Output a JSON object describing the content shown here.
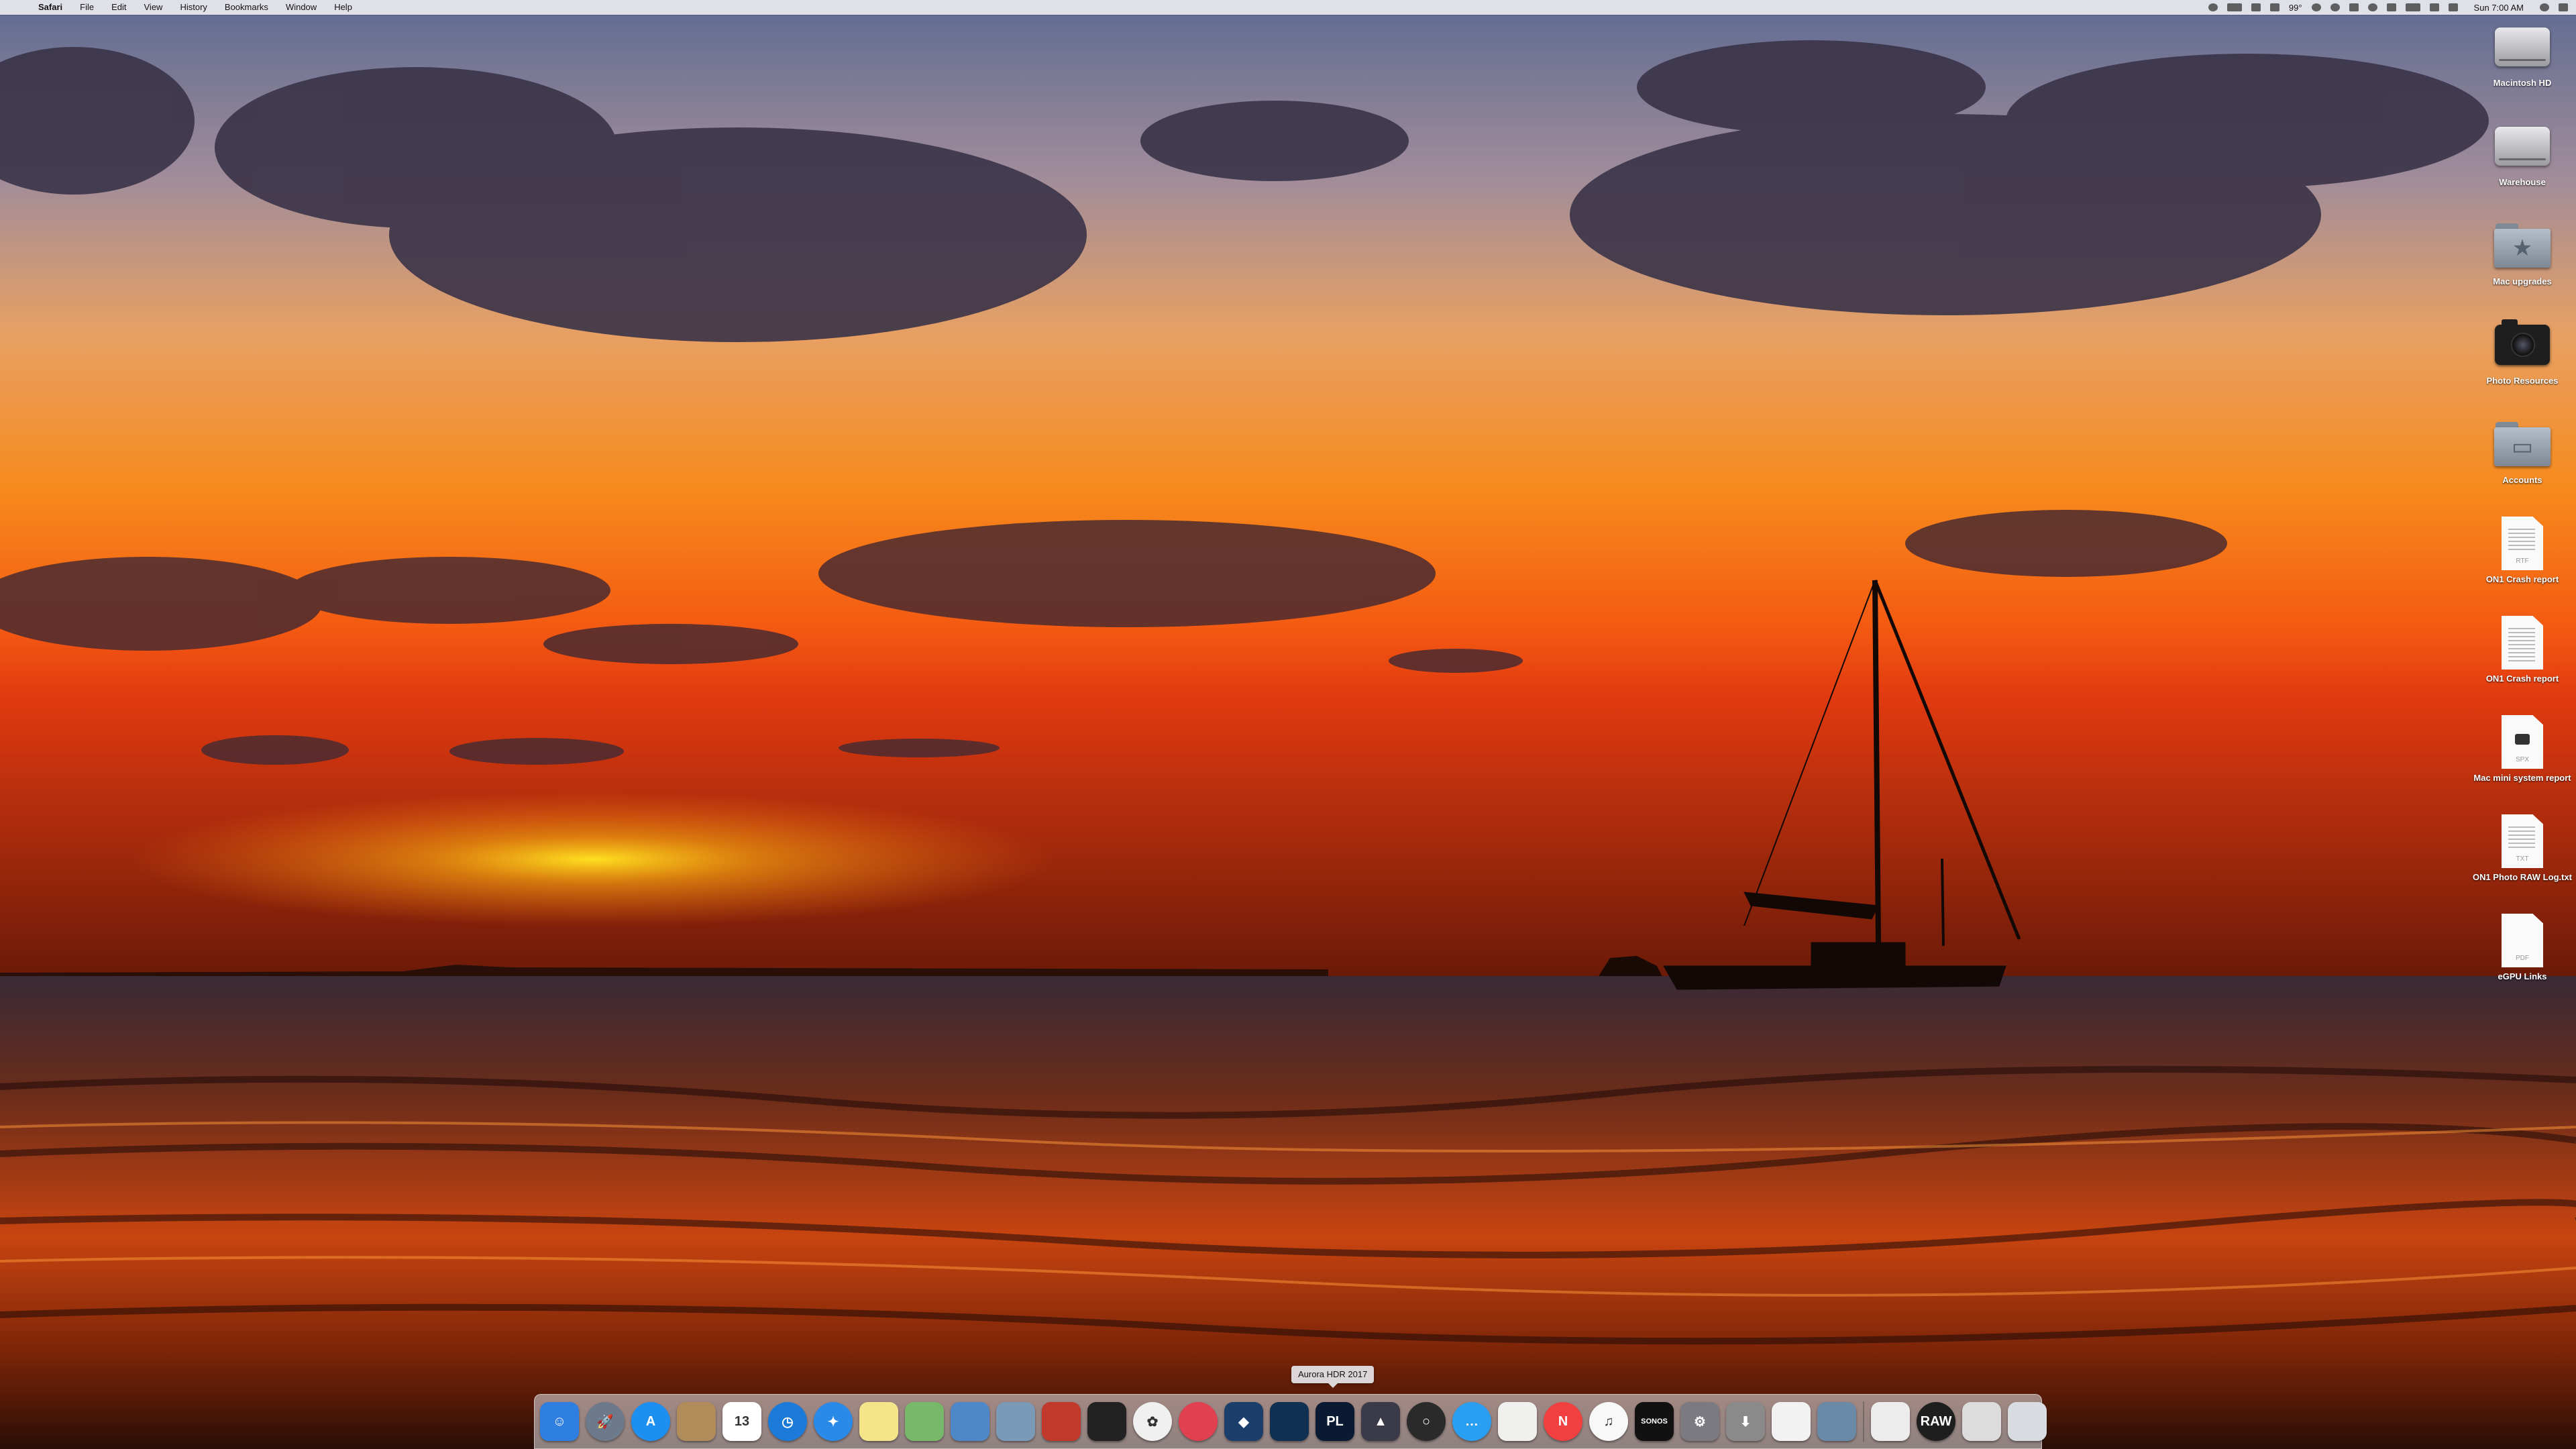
{
  "menubar": {
    "apple_glyph": "",
    "items": [
      "Safari",
      "File",
      "Edit",
      "View",
      "History",
      "Bookmarks",
      "Window",
      "Help"
    ],
    "status": {
      "temperature": "99°",
      "clock": "Sun 7:00 AM"
    }
  },
  "desktop_icons": [
    {
      "label": "Macintosh HD",
      "kind": "disk"
    },
    {
      "label": "Warehouse",
      "kind": "disk"
    },
    {
      "label": "Mac upgrades",
      "kind": "folder"
    },
    {
      "label": "Photo Resources",
      "kind": "camera"
    },
    {
      "label": "Accounts",
      "kind": "folder"
    },
    {
      "label": "ON1 Crash report",
      "kind": "doc",
      "ext": "RTF"
    },
    {
      "label": "ON1 Crash report",
      "kind": "doc",
      "ext": ""
    },
    {
      "label": "Mac mini system report",
      "kind": "doc",
      "ext": "SPX"
    },
    {
      "label": "ON1 Photo RAW Log.txt",
      "kind": "doc",
      "ext": "TXT"
    },
    {
      "label": "eGPU Links",
      "kind": "doc",
      "ext": "PDF"
    }
  ],
  "dock": {
    "tooltip": "Aurora HDR 2017",
    "items": [
      {
        "name": "finder",
        "glyph": "☺",
        "color": "#2f7fe0"
      },
      {
        "name": "launchpad",
        "glyph": "🚀",
        "color": "#6c7a8c"
      },
      {
        "name": "app-store",
        "glyph": "A",
        "color": "#1d8ff0"
      },
      {
        "name": "contacts",
        "glyph": "",
        "color": "#b08c5a"
      },
      {
        "name": "calendar",
        "glyph": "13",
        "color": "#ffffff"
      },
      {
        "name": "time-machine",
        "glyph": "◷",
        "color": "#1c7bd8"
      },
      {
        "name": "safari",
        "glyph": "✦",
        "color": "#2a8ae8"
      },
      {
        "name": "notes",
        "glyph": "",
        "color": "#f4e58a"
      },
      {
        "name": "maps",
        "glyph": "",
        "color": "#78b86a"
      },
      {
        "name": "preview",
        "glyph": "",
        "color": "#4e88c8"
      },
      {
        "name": "image-capture",
        "glyph": "",
        "color": "#7a9ab8"
      },
      {
        "name": "photo-booth",
        "glyph": "",
        "color": "#c0392b"
      },
      {
        "name": "airdrop",
        "glyph": "",
        "color": "#222222"
      },
      {
        "name": "photos",
        "glyph": "✿",
        "color": "#f0f0f0"
      },
      {
        "name": "on1",
        "glyph": "",
        "color": "#e04050"
      },
      {
        "name": "affinity",
        "glyph": "◆",
        "color": "#1b3f6a"
      },
      {
        "name": "layers",
        "glyph": "",
        "color": "#0f3050"
      },
      {
        "name": "photolab",
        "glyph": "PL",
        "color": "#0a1a33"
      },
      {
        "name": "aurora-hdr",
        "glyph": "▲",
        "color": "#3a3a48"
      },
      {
        "name": "lens-app",
        "glyph": "○",
        "color": "#2a2a2a"
      },
      {
        "name": "messages",
        "glyph": "…",
        "color": "#2a9ff2"
      },
      {
        "name": "textedit",
        "glyph": "",
        "color": "#f0f0ee"
      },
      {
        "name": "news",
        "glyph": "N",
        "color": "#f24040"
      },
      {
        "name": "itunes",
        "glyph": "♫",
        "color": "#f8f8f8"
      },
      {
        "name": "sonos",
        "glyph": "SONOS",
        "color": "#111111"
      },
      {
        "name": "system-preferences",
        "glyph": "⚙",
        "color": "#7a7a80"
      },
      {
        "name": "downloads",
        "glyph": "⬇",
        "color": "#8a8a8a"
      },
      {
        "name": "documents",
        "glyph": "",
        "color": "#f2f2f2"
      },
      {
        "name": "image-folder",
        "glyph": "",
        "color": "#6a8aa8"
      },
      {
        "name": "file",
        "glyph": "",
        "color": "#ececec"
      },
      {
        "name": "raw",
        "glyph": "RAW",
        "color": "#1e1e1e"
      },
      {
        "name": "window-stack",
        "glyph": "",
        "color": "#dcdcdc"
      },
      {
        "name": "trash",
        "glyph": "",
        "color": "#d8dce0"
      }
    ]
  }
}
